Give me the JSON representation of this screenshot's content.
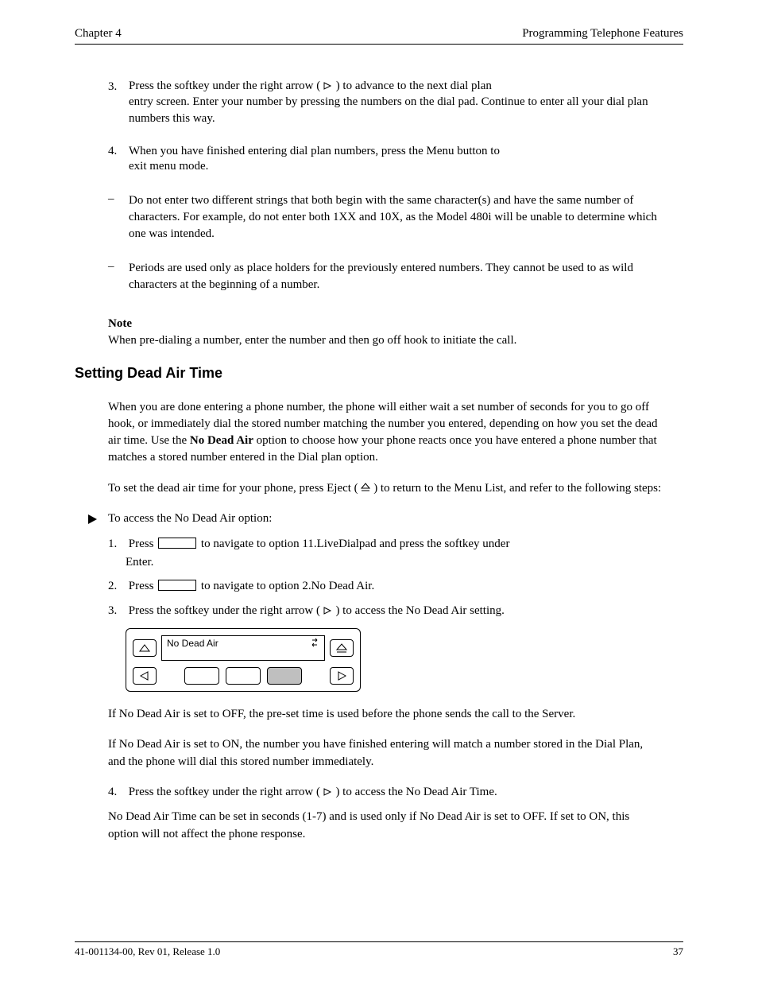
{
  "header": {
    "left": "Chapter 4",
    "right": "Programming Telephone Features"
  },
  "item3": {
    "num": "3.",
    "line1a": "Press the softkey under the right arrow (",
    "line1b": ") to advance to the next dial plan",
    "cont": "entry screen. Enter your number by pressing the numbers on the dial pad. Continue to enter all your dial plan numbers this way."
  },
  "item4": {
    "num": "4.",
    "line1": "When you have finished entering dial plan numbers, press the Menu button to",
    "cont": "exit menu mode."
  },
  "bulletA": "Do not enter two different strings that both begin with the same character(s) and have the same number of characters. For example, do not enter both 1XX and 10X, as the Model 480i will be unable to determine which one was intended.",
  "bulletB": "Periods are used only as place holders for the previously entered numbers. They cannot be used to as wild characters at the beginning of a number.",
  "note": {
    "label": "Note",
    "text": "When pre-dialing a number, enter the number and then go off hook to initiate the call."
  },
  "section": {
    "title": "Setting Dead Air Time",
    "intro_a": "When you are done entering a phone number, the phone will either wait a set number of seconds for you to go off hook, or immediately dial the stored number matching the number you entered, depending on how you set the dead air time. Use the ",
    "intro_bold": "No Dead Air",
    "intro_b": " option to choose how your phone reacts once you have entered a phone number that matches a stored number entered in the Dial plan option.",
    "intro_c": "To set the dead air time for your phone, press Eject (",
    "intro_d": ") to return to the Menu List, and refer to the following steps:"
  },
  "steps": {
    "lead": "To access the No Dead Air option:",
    "s1a": "Press ",
    "s1b": " to navigate to option 11.LiveDialpad and press the softkey under ",
    "s1c": "Enter.",
    "s2a": "Press ",
    "s2b": " to navigate to option 2.No Dead Air.",
    "s3a": "Press the softkey under the right arrow ( ",
    "s3b": " ) to access the No Dead Air setting."
  },
  "lcd": {
    "text": "No Dead Air"
  },
  "after": {
    "p1": "If No Dead Air is set to OFF, the pre-set time is used before the phone sends the call to the Server.",
    "p2": "If No Dead Air is set to ON, the number you have finished entering will match a number stored in the Dial Plan, and the phone will dial this stored number immediately.",
    "s4a": "Press the softkey under the right arrow ( ",
    "s4b": " ) to access the No Dead Air Time.",
    "p3": "No Dead Air Time can be set in seconds (1-7) and is used only if No Dead Air is set to OFF. If set to ON, this option will not affect the phone response."
  },
  "footer": {
    "left": "41-001134-00, Rev 01, Release 1.0",
    "right": "37"
  }
}
